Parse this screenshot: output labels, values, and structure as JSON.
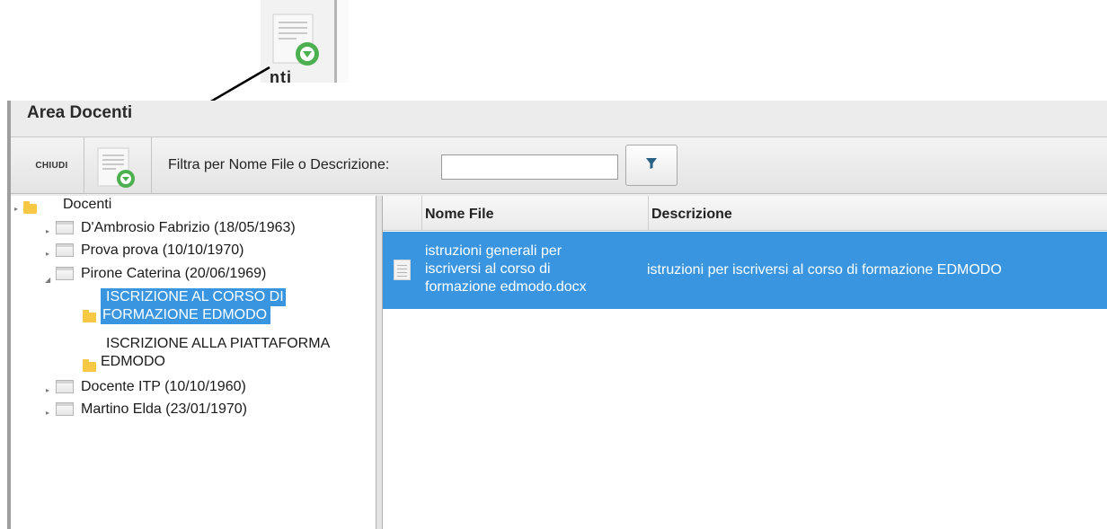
{
  "callout": {
    "label": "nti"
  },
  "window": {
    "title": "Area Docenti"
  },
  "toolbar": {
    "close_label": "CHIUDI",
    "filter_label": "Filtra per Nome File o Descrizione:",
    "filter_value": "",
    "filter_placeholder": ""
  },
  "tree": {
    "root": "Docenti",
    "items": [
      {
        "label": "D'Ambrosio Fabrizio (18/05/1963)",
        "expanded": false
      },
      {
        "label": "Prova prova (10/10/1970)",
        "expanded": false
      },
      {
        "label": "Pirone Caterina (20/06/1969)",
        "expanded": true,
        "children": [
          {
            "label_line1": "ISCRIZIONE AL CORSO DI",
            "label_line2": "FORMAZIONE EDMODO",
            "selected": true
          },
          {
            "label_line1": "ISCRIZIONE ALLA PIATTAFORMA",
            "label_line2": "EDMODO",
            "selected": false
          }
        ]
      },
      {
        "label": "Docente ITP (10/10/1960)",
        "expanded": false
      },
      {
        "label": "Martino Elda (23/01/1970)",
        "expanded": false
      }
    ]
  },
  "grid": {
    "columns": [
      "Nome File",
      "Descrizione"
    ],
    "rows": [
      {
        "file_line1": "istruzioni generali per",
        "file_line2": "iscriversi al corso di",
        "file_line3": "formazione edmodo.docx",
        "description": "istruzioni per iscriversi al corso di formazione EDMODO",
        "selected": true
      }
    ]
  },
  "colors": {
    "selection": "#3a95e0",
    "folder": "#f7c844",
    "add_badge": "#4caf50",
    "filter_icon": "#2a5f86"
  }
}
